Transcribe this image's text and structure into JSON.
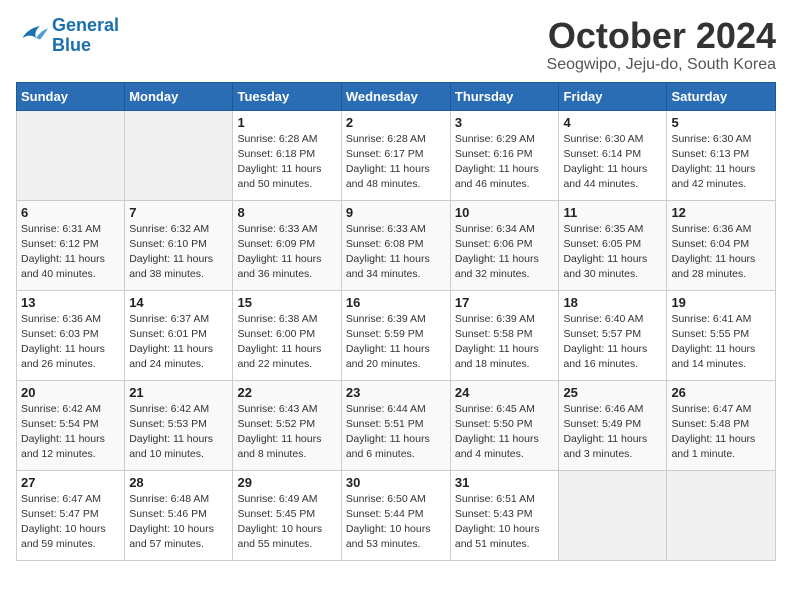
{
  "logo": {
    "line1": "General",
    "line2": "Blue"
  },
  "title": "October 2024",
  "location": "Seogwipo, Jeju-do, South Korea",
  "days_of_week": [
    "Sunday",
    "Monday",
    "Tuesday",
    "Wednesday",
    "Thursday",
    "Friday",
    "Saturday"
  ],
  "weeks": [
    [
      {
        "day": "",
        "sunrise": "",
        "sunset": "",
        "daylight": ""
      },
      {
        "day": "",
        "sunrise": "",
        "sunset": "",
        "daylight": ""
      },
      {
        "day": "1",
        "sunrise": "Sunrise: 6:28 AM",
        "sunset": "Sunset: 6:18 PM",
        "daylight": "Daylight: 11 hours and 50 minutes."
      },
      {
        "day": "2",
        "sunrise": "Sunrise: 6:28 AM",
        "sunset": "Sunset: 6:17 PM",
        "daylight": "Daylight: 11 hours and 48 minutes."
      },
      {
        "day": "3",
        "sunrise": "Sunrise: 6:29 AM",
        "sunset": "Sunset: 6:16 PM",
        "daylight": "Daylight: 11 hours and 46 minutes."
      },
      {
        "day": "4",
        "sunrise": "Sunrise: 6:30 AM",
        "sunset": "Sunset: 6:14 PM",
        "daylight": "Daylight: 11 hours and 44 minutes."
      },
      {
        "day": "5",
        "sunrise": "Sunrise: 6:30 AM",
        "sunset": "Sunset: 6:13 PM",
        "daylight": "Daylight: 11 hours and 42 minutes."
      }
    ],
    [
      {
        "day": "6",
        "sunrise": "Sunrise: 6:31 AM",
        "sunset": "Sunset: 6:12 PM",
        "daylight": "Daylight: 11 hours and 40 minutes."
      },
      {
        "day": "7",
        "sunrise": "Sunrise: 6:32 AM",
        "sunset": "Sunset: 6:10 PM",
        "daylight": "Daylight: 11 hours and 38 minutes."
      },
      {
        "day": "8",
        "sunrise": "Sunrise: 6:33 AM",
        "sunset": "Sunset: 6:09 PM",
        "daylight": "Daylight: 11 hours and 36 minutes."
      },
      {
        "day": "9",
        "sunrise": "Sunrise: 6:33 AM",
        "sunset": "Sunset: 6:08 PM",
        "daylight": "Daylight: 11 hours and 34 minutes."
      },
      {
        "day": "10",
        "sunrise": "Sunrise: 6:34 AM",
        "sunset": "Sunset: 6:06 PM",
        "daylight": "Daylight: 11 hours and 32 minutes."
      },
      {
        "day": "11",
        "sunrise": "Sunrise: 6:35 AM",
        "sunset": "Sunset: 6:05 PM",
        "daylight": "Daylight: 11 hours and 30 minutes."
      },
      {
        "day": "12",
        "sunrise": "Sunrise: 6:36 AM",
        "sunset": "Sunset: 6:04 PM",
        "daylight": "Daylight: 11 hours and 28 minutes."
      }
    ],
    [
      {
        "day": "13",
        "sunrise": "Sunrise: 6:36 AM",
        "sunset": "Sunset: 6:03 PM",
        "daylight": "Daylight: 11 hours and 26 minutes."
      },
      {
        "day": "14",
        "sunrise": "Sunrise: 6:37 AM",
        "sunset": "Sunset: 6:01 PM",
        "daylight": "Daylight: 11 hours and 24 minutes."
      },
      {
        "day": "15",
        "sunrise": "Sunrise: 6:38 AM",
        "sunset": "Sunset: 6:00 PM",
        "daylight": "Daylight: 11 hours and 22 minutes."
      },
      {
        "day": "16",
        "sunrise": "Sunrise: 6:39 AM",
        "sunset": "Sunset: 5:59 PM",
        "daylight": "Daylight: 11 hours and 20 minutes."
      },
      {
        "day": "17",
        "sunrise": "Sunrise: 6:39 AM",
        "sunset": "Sunset: 5:58 PM",
        "daylight": "Daylight: 11 hours and 18 minutes."
      },
      {
        "day": "18",
        "sunrise": "Sunrise: 6:40 AM",
        "sunset": "Sunset: 5:57 PM",
        "daylight": "Daylight: 11 hours and 16 minutes."
      },
      {
        "day": "19",
        "sunrise": "Sunrise: 6:41 AM",
        "sunset": "Sunset: 5:55 PM",
        "daylight": "Daylight: 11 hours and 14 minutes."
      }
    ],
    [
      {
        "day": "20",
        "sunrise": "Sunrise: 6:42 AM",
        "sunset": "Sunset: 5:54 PM",
        "daylight": "Daylight: 11 hours and 12 minutes."
      },
      {
        "day": "21",
        "sunrise": "Sunrise: 6:42 AM",
        "sunset": "Sunset: 5:53 PM",
        "daylight": "Daylight: 11 hours and 10 minutes."
      },
      {
        "day": "22",
        "sunrise": "Sunrise: 6:43 AM",
        "sunset": "Sunset: 5:52 PM",
        "daylight": "Daylight: 11 hours and 8 minutes."
      },
      {
        "day": "23",
        "sunrise": "Sunrise: 6:44 AM",
        "sunset": "Sunset: 5:51 PM",
        "daylight": "Daylight: 11 hours and 6 minutes."
      },
      {
        "day": "24",
        "sunrise": "Sunrise: 6:45 AM",
        "sunset": "Sunset: 5:50 PM",
        "daylight": "Daylight: 11 hours and 4 minutes."
      },
      {
        "day": "25",
        "sunrise": "Sunrise: 6:46 AM",
        "sunset": "Sunset: 5:49 PM",
        "daylight": "Daylight: 11 hours and 3 minutes."
      },
      {
        "day": "26",
        "sunrise": "Sunrise: 6:47 AM",
        "sunset": "Sunset: 5:48 PM",
        "daylight": "Daylight: 11 hours and 1 minute."
      }
    ],
    [
      {
        "day": "27",
        "sunrise": "Sunrise: 6:47 AM",
        "sunset": "Sunset: 5:47 PM",
        "daylight": "Daylight: 10 hours and 59 minutes."
      },
      {
        "day": "28",
        "sunrise": "Sunrise: 6:48 AM",
        "sunset": "Sunset: 5:46 PM",
        "daylight": "Daylight: 10 hours and 57 minutes."
      },
      {
        "day": "29",
        "sunrise": "Sunrise: 6:49 AM",
        "sunset": "Sunset: 5:45 PM",
        "daylight": "Daylight: 10 hours and 55 minutes."
      },
      {
        "day": "30",
        "sunrise": "Sunrise: 6:50 AM",
        "sunset": "Sunset: 5:44 PM",
        "daylight": "Daylight: 10 hours and 53 minutes."
      },
      {
        "day": "31",
        "sunrise": "Sunrise: 6:51 AM",
        "sunset": "Sunset: 5:43 PM",
        "daylight": "Daylight: 10 hours and 51 minutes."
      },
      {
        "day": "",
        "sunrise": "",
        "sunset": "",
        "daylight": ""
      },
      {
        "day": "",
        "sunrise": "",
        "sunset": "",
        "daylight": ""
      }
    ]
  ]
}
